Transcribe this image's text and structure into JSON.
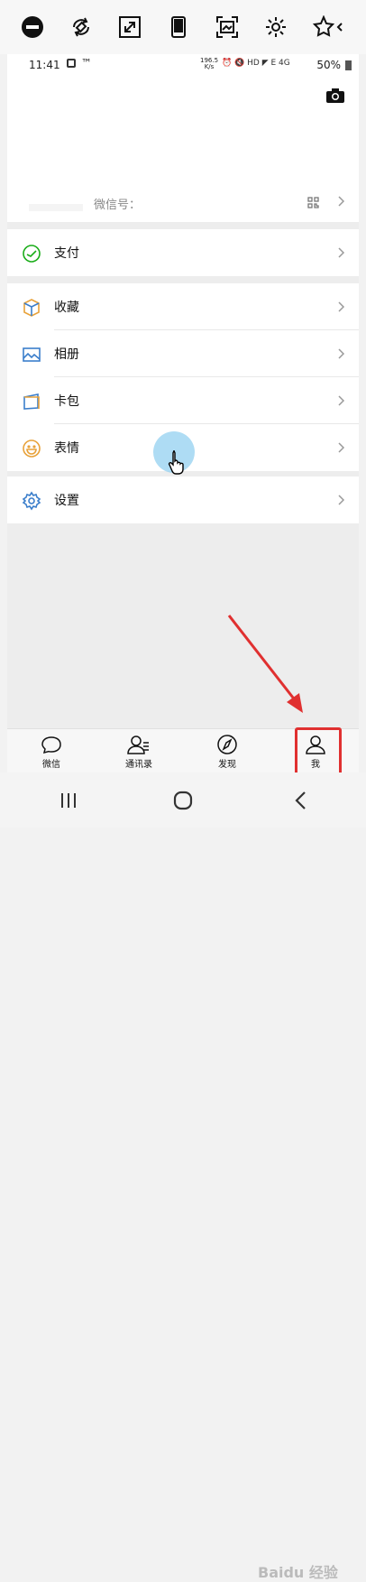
{
  "toolbar": {
    "icons": [
      "minus-circle-icon",
      "rotate-icon",
      "expand-icon",
      "phone-icon",
      "screenshot-icon",
      "gear-icon",
      "star-icon"
    ]
  },
  "statusbar": {
    "time": "11:41",
    "net_speed": "196.5",
    "net_unit": "K/s",
    "battery": "50%"
  },
  "profile": {
    "wechat_id_label": "微信号："
  },
  "menu": {
    "pay": "支付",
    "favorites": "收藏",
    "album": "相册",
    "cards": "卡包",
    "stickers": "表情",
    "settings": "设置"
  },
  "tabbar": {
    "chats": "微信",
    "contacts": "通讯录",
    "discover": "发现",
    "me": "我"
  },
  "watermark": "Baidu 经验",
  "colors": {
    "green": "#1aad19",
    "blue": "#3b7ecb",
    "orange": "#e8a23a",
    "red_annotation": "#e03030"
  }
}
